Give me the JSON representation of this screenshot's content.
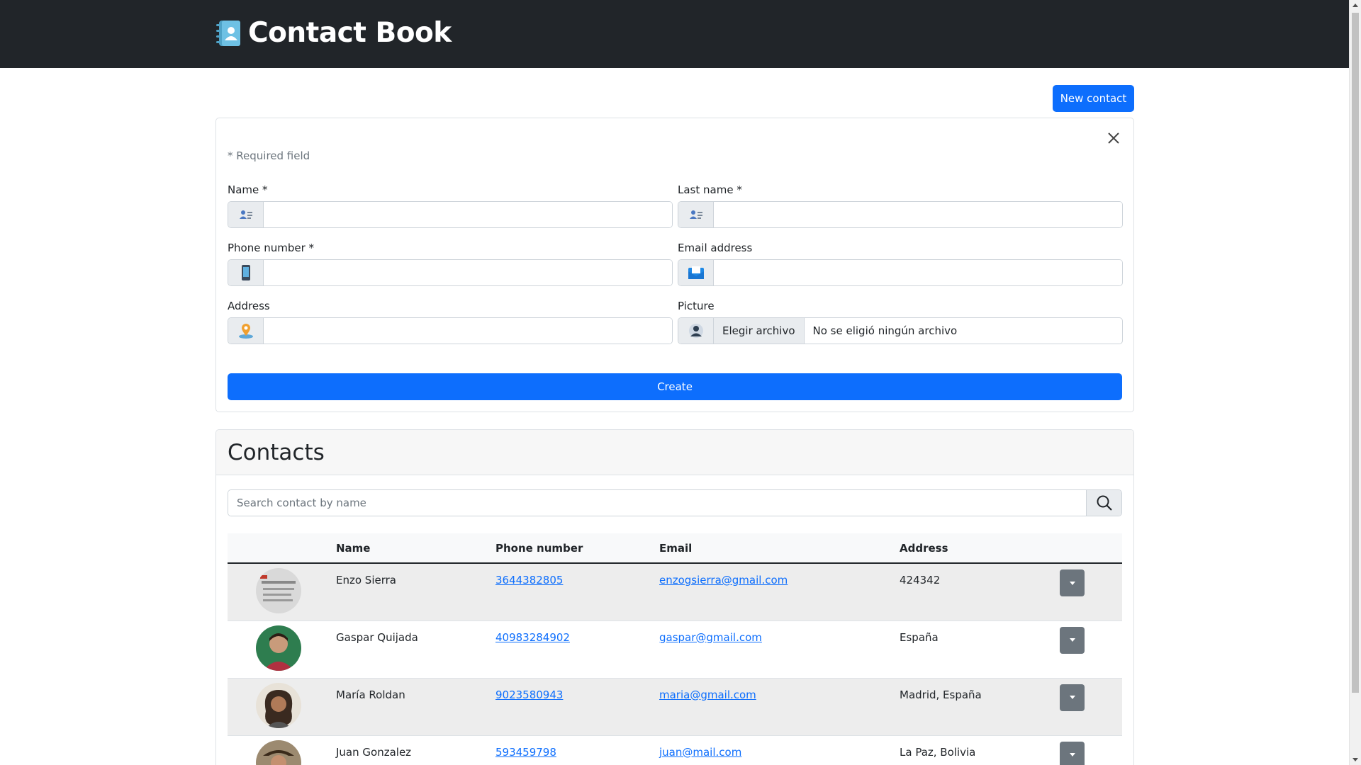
{
  "app": {
    "title": "Contact Book",
    "logo_icon": "address-book-icon"
  },
  "toolbar": {
    "new_contact_label": "New contact"
  },
  "form": {
    "required_note": "* Required field",
    "name_label": "Name *",
    "last_name_label": "Last name *",
    "phone_label": "Phone number *",
    "email_label": "Email address",
    "address_label": "Address",
    "picture_label": "Picture",
    "file_button": "Elegir archivo",
    "file_status": "No se eligió ningún archivo",
    "create_label": "Create",
    "values": {
      "name": "",
      "last_name": "",
      "phone": "",
      "email": "",
      "address": ""
    }
  },
  "contacts": {
    "title": "Contacts",
    "search_placeholder": "Search contact by name",
    "columns": [
      "",
      "Name",
      "Phone number",
      "Email",
      "Address",
      ""
    ],
    "rows": [
      {
        "name": "Enzo Sierra",
        "phone": "3644382805",
        "email": "enzogsierra@gmail.com",
        "address": "424342"
      },
      {
        "name": "Gaspar Quijada",
        "phone": "40983284902",
        "email": "gaspar@gmail.com",
        "address": "España"
      },
      {
        "name": "María Roldan",
        "phone": "9023580943",
        "email": "maria@gmail.com",
        "address": "Madrid, España"
      },
      {
        "name": "Juan Gonzalez",
        "phone": "593459798",
        "email": "juan@mail.com",
        "address": "La Paz, Bolivia"
      }
    ]
  },
  "colors": {
    "navbar": "#212529",
    "primary": "#0d6efd",
    "secondary": "#6c757d"
  }
}
